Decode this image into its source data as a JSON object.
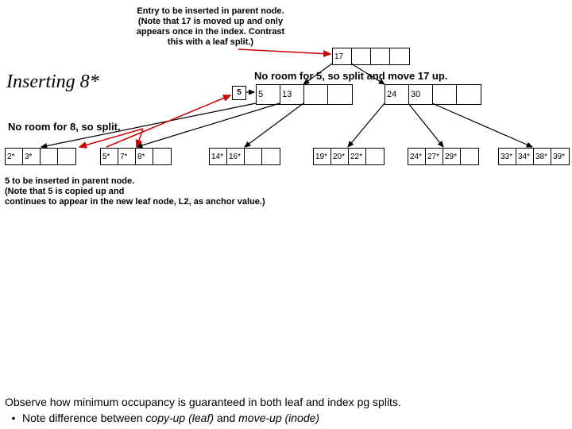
{
  "title": "Inserting 8*",
  "annot_top": {
    "l1": "Entry to be inserted in parent node.",
    "l2": "(Note that 17 is moved up and only",
    "l3": "appears once in the index. Contrast",
    "l4": "this with a leaf split.)"
  },
  "msg_5": "No room for 5, so split and move 17 up.",
  "msg_8": "No room for 8, so split.",
  "annot_bot1": "5 to be inserted in parent node.",
  "annot_bot2a": "(Note that 5 is",
  "annot_bot2b": " copied up and",
  "annot_bot3": "continues to appear in the new leaf node, L2, as anchor value.)",
  "obs1": "Observe how minimum occupancy is guaranteed in both leaf and index pg splits.",
  "obs2a": "Note difference between ",
  "obs2b": "copy-up (leaf)",
  "obs2c": " and ",
  "obs2d": "move-up (inode)",
  "new_root": {
    "c0": "17",
    "c1": "",
    "c2": "",
    "c3": ""
  },
  "idx_left": {
    "c0": "5",
    "c1": "13",
    "c2": "",
    "c3": ""
  },
  "idx_right": {
    "c0": "24",
    "c1": "30",
    "c2": "",
    "c3": ""
  },
  "five": "5",
  "leaf1": {
    "c0": "2*",
    "c1": "3*",
    "c2": "",
    "c3": ""
  },
  "leaf2": {
    "c0": "5*",
    "c1": "7*",
    "c2": "8*",
    "c3": ""
  },
  "leaf3": {
    "c0": "14*",
    "c1": "16*",
    "c2": "",
    "c3": ""
  },
  "leaf4": {
    "c0": "19*",
    "c1": "20*",
    "c2": "22*",
    "c3": ""
  },
  "leaf5": {
    "c0": "24*",
    "c1": "27*",
    "c2": "29*",
    "c3": ""
  },
  "leaf6": {
    "c0": "33*",
    "c1": "34*",
    "c2": "38*",
    "c3": "39*"
  },
  "bullet": "•"
}
